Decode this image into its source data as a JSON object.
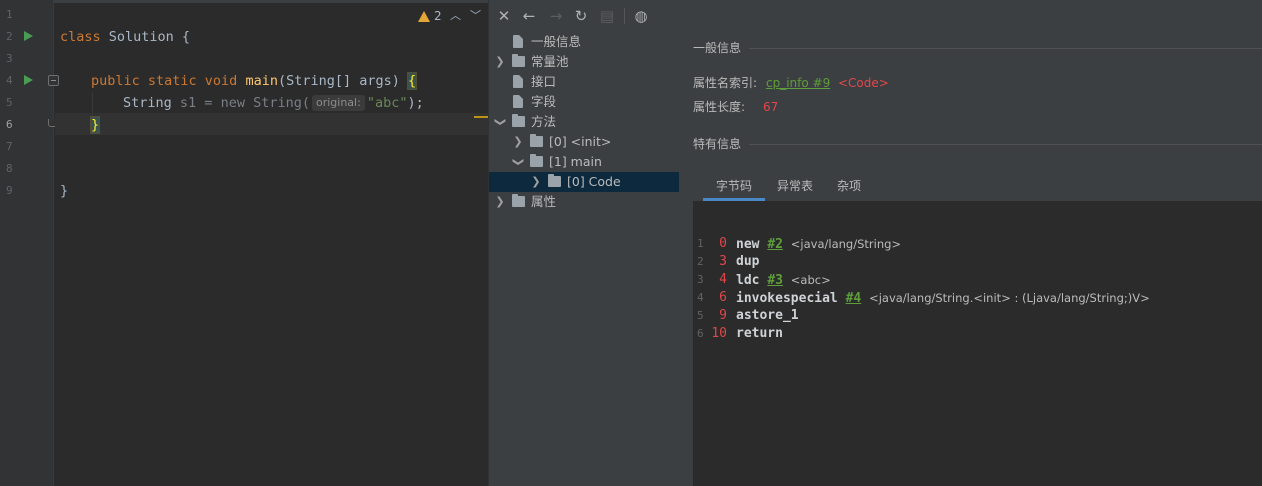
{
  "editor": {
    "line_numbers": [
      "1",
      "2",
      "3",
      "4",
      "5",
      "6",
      "7",
      "8",
      "9"
    ],
    "code": {
      "l2_kw": "class",
      "l2_rest": " Solution {",
      "l4_kw": "public static void",
      "l4_fn": "main",
      "l4_rest": "(String[] args) ",
      "l4_brace": "{",
      "l5_type": "String ",
      "l5_var": "s1",
      "l5_eq": " = ",
      "l5_new": "new",
      "l5_ctor": " String(",
      "l5_hint": "original:",
      "l5_str": "\"abc\"",
      "l5_end": ");",
      "l6_brace": "}",
      "l9_brace": "}"
    },
    "warnings_count": "2",
    "colors": {
      "keyword": "#cc7832",
      "function": "#ffc66d",
      "string": "#6a8759",
      "text": "#a9b7c6"
    }
  },
  "toolbar": {
    "close_icon": "close-icon",
    "back_icon": "arrow-left-icon",
    "forward_icon": "arrow-right-icon",
    "refresh_icon": "refresh-icon",
    "save_icon": "save-icon",
    "web_icon": "globe-icon"
  },
  "tree": {
    "general": "一般信息",
    "constant_pool": "常量池",
    "interfaces": "接口",
    "fields": "字段",
    "methods": "方法",
    "method_init": "[0] <init>",
    "method_main": "[1] main",
    "code": "[0] Code",
    "attributes": "属性"
  },
  "detail": {
    "general_title": "一般信息",
    "attr_name_label": "属性名索引:",
    "attr_name_link": "cp_info #9",
    "attr_name_value": "<Code>",
    "attr_len_label": "属性长度:",
    "attr_len_value": "67",
    "specific_title": "特有信息",
    "tabs": [
      "字节码",
      "异常表",
      "杂项"
    ],
    "active_tab": "字节码",
    "bytecode": [
      {
        "line": "1",
        "offset": "0",
        "op": "new",
        "ref": "#2",
        "comment": "<java/lang/String>"
      },
      {
        "line": "2",
        "offset": "3",
        "op": "dup",
        "ref": "",
        "comment": ""
      },
      {
        "line": "3",
        "offset": "4",
        "op": "ldc",
        "ref": "#3",
        "comment": "<abc>"
      },
      {
        "line": "4",
        "offset": "6",
        "op": "invokespecial",
        "ref": "#4",
        "comment": "<java/lang/String.<init> : (Ljava/lang/String;)V>"
      },
      {
        "line": "5",
        "offset": "9",
        "op": "astore_1",
        "ref": "",
        "comment": ""
      },
      {
        "line": "6",
        "offset": "10",
        "op": "return",
        "ref": "",
        "comment": ""
      }
    ]
  }
}
